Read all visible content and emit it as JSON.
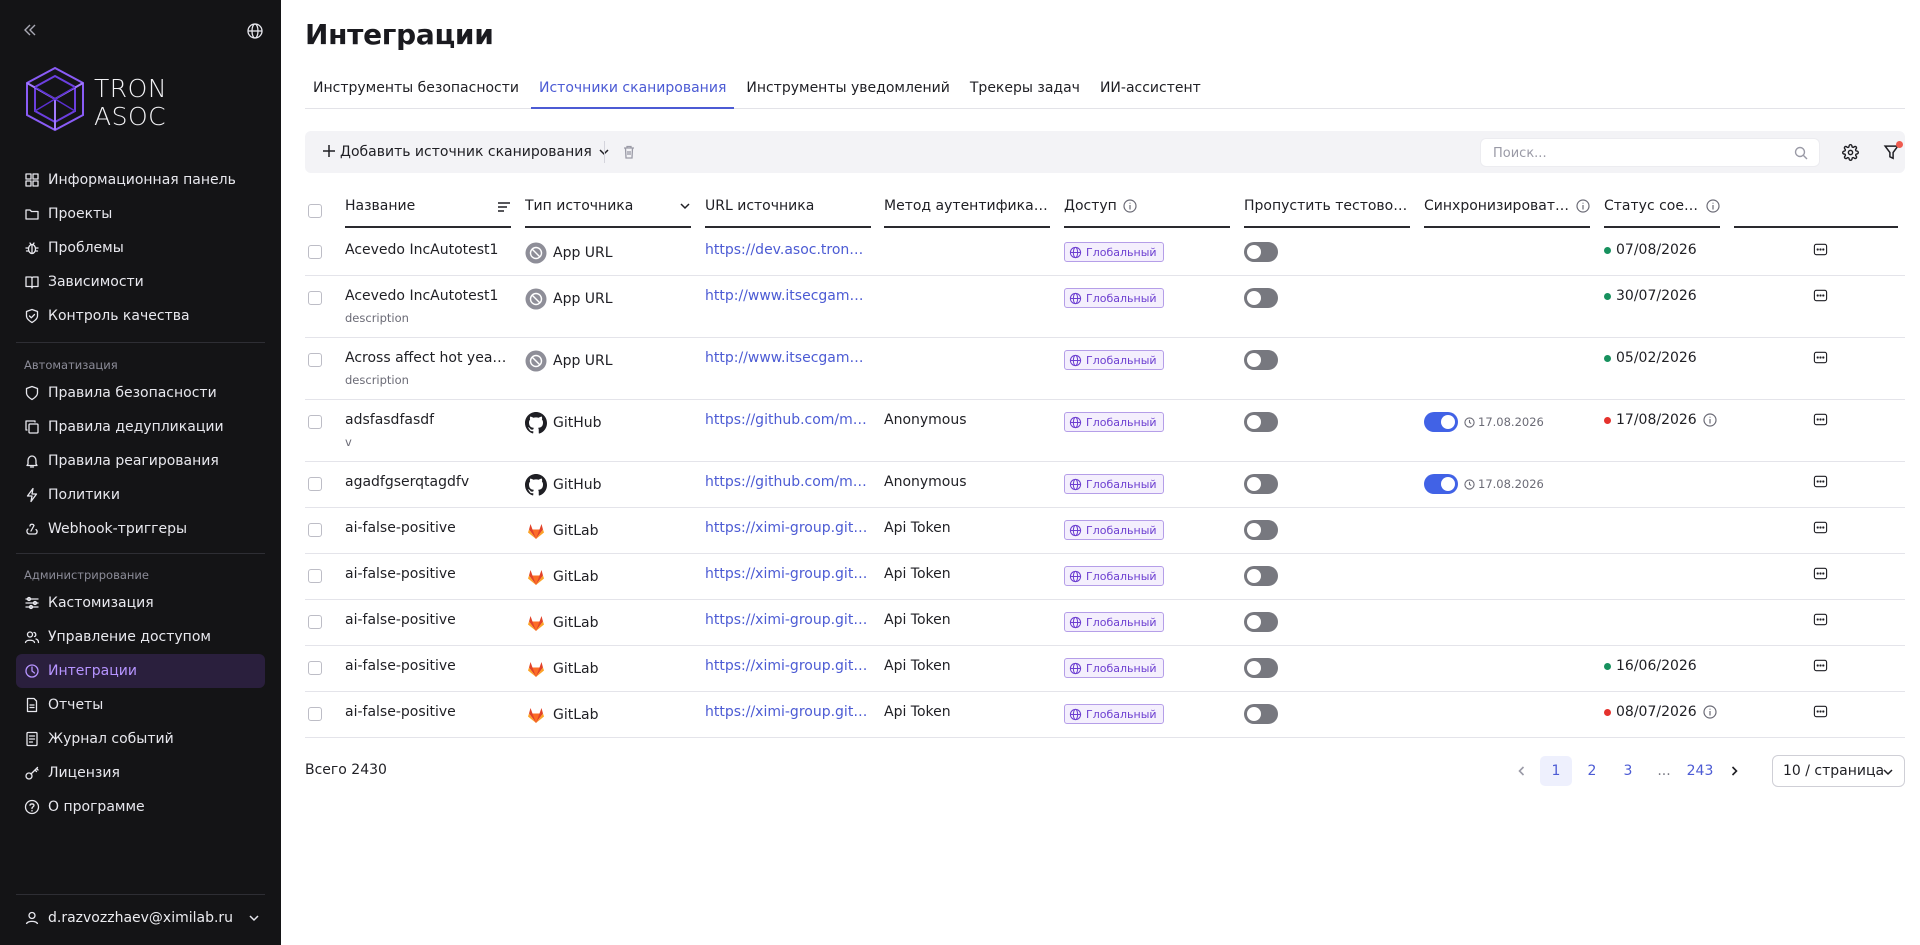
{
  "sidebar": {
    "logo_line1": "TRON",
    "logo_line2": "ASOC",
    "nav_main": [
      {
        "label": "Информационная панель",
        "icon": "dashboard-icon"
      },
      {
        "label": "Проекты",
        "icon": "folder-icon"
      },
      {
        "label": "Проблемы",
        "icon": "bug-icon"
      },
      {
        "label": "Зависимости",
        "icon": "book-icon"
      },
      {
        "label": "Контроль качества",
        "icon": "shield-check-icon"
      }
    ],
    "section_automation": "Автоматизация",
    "nav_automation": [
      {
        "label": "Правила безопасности",
        "icon": "shield-icon"
      },
      {
        "label": "Правила дедупликации",
        "icon": "copy-icon"
      },
      {
        "label": "Правила реагирования",
        "icon": "bell-icon"
      },
      {
        "label": "Политики",
        "icon": "bolt-icon"
      },
      {
        "label": "Webhook-триггеры",
        "icon": "webhook-icon"
      }
    ],
    "section_admin": "Администрирование",
    "nav_admin": [
      {
        "label": "Кастомизация",
        "icon": "sliders-icon"
      },
      {
        "label": "Управление доступом",
        "icon": "users-icon"
      },
      {
        "label": "Интеграции",
        "icon": "integrations-icon",
        "active": true
      },
      {
        "label": "Отчеты",
        "icon": "report-icon"
      },
      {
        "label": "Журнал событий",
        "icon": "journal-icon"
      },
      {
        "label": "Лицензия",
        "icon": "key-icon"
      },
      {
        "label": "О программе",
        "icon": "help-icon"
      }
    ],
    "user": "d.razvozzhaev@ximilab.ru"
  },
  "page": {
    "title": "Интеграции",
    "tabs": [
      {
        "label": "Инструменты безопасности"
      },
      {
        "label": "Источники сканирования",
        "active": true
      },
      {
        "label": "Инструменты уведомлений"
      },
      {
        "label": "Трекеры задач"
      },
      {
        "label": "ИИ-ассистент"
      }
    ]
  },
  "toolbar": {
    "add_label": "Добавить источник сканирования",
    "search_placeholder": "Поиск..."
  },
  "table": {
    "columns": {
      "name": "Название",
      "type": "Тип источника",
      "url": "URL источника",
      "auth": "Метод аутентификации",
      "access": "Доступ",
      "skip": "Пропустить тестовое с...",
      "sync": "Синхронизировать ...",
      "status": "Статус соед..."
    },
    "rows": [
      {
        "name": "Acevedo IncAutotest1",
        "desc": "",
        "type": "App URL",
        "type_icon": "app-url",
        "url": "https://dev.asoc.tronaso...",
        "auth": "",
        "access": "Глобальный",
        "skip": false,
        "sync": null,
        "sync_date": "",
        "status_date": "07/08/2026",
        "status_color": "#17915e",
        "status_info": false
      },
      {
        "name": "Acevedo IncAutotest1",
        "desc": "description",
        "type": "App URL",
        "type_icon": "app-url",
        "url": "http://www.itsecgames....",
        "auth": "",
        "access": "Глобальный",
        "skip": false,
        "sync": null,
        "sync_date": "",
        "status_date": "30/07/2026",
        "status_color": "#17915e",
        "status_info": false
      },
      {
        "name": "Across affect hot year c...",
        "desc": "description",
        "type": "App URL",
        "type_icon": "app-url",
        "url": "http://www.itsecgames....",
        "auth": "",
        "access": "Глобальный",
        "skip": false,
        "sync": null,
        "sync_date": "",
        "status_date": "05/02/2026",
        "status_color": "#17915e",
        "status_info": false
      },
      {
        "name": "adsfasdfasdf",
        "desc": "v",
        "type": "GitHub",
        "type_icon": "github",
        "url": "https://github.com/my-o...",
        "auth": "Anonymous",
        "access": "Глобальный",
        "skip": false,
        "sync": true,
        "sync_date": "17.08.2026",
        "status_date": "17/08/2026",
        "status_color": "#e5322d",
        "status_info": true
      },
      {
        "name": "agadfgserqtagdfv",
        "desc": "",
        "type": "GitHub",
        "type_icon": "github",
        "url": "https://github.com/my-o...",
        "auth": "Anonymous",
        "access": "Глобальный",
        "skip": false,
        "sync": true,
        "sync_date": "17.08.2026",
        "status_date": "",
        "status_color": "",
        "status_info": false
      },
      {
        "name": "ai-false-positive",
        "desc": "",
        "type": "GitLab",
        "type_icon": "gitlab",
        "url": "https://ximi-group.gitlab...",
        "auth": "Api Token",
        "access": "Глобальный",
        "skip": false,
        "sync": null,
        "sync_date": "",
        "status_date": "",
        "status_color": "",
        "status_info": false
      },
      {
        "name": "ai-false-positive",
        "desc": "",
        "type": "GitLab",
        "type_icon": "gitlab",
        "url": "https://ximi-group.gitlab...",
        "auth": "Api Token",
        "access": "Глобальный",
        "skip": false,
        "sync": null,
        "sync_date": "",
        "status_date": "",
        "status_color": "",
        "status_info": false
      },
      {
        "name": "ai-false-positive",
        "desc": "",
        "type": "GitLab",
        "type_icon": "gitlab",
        "url": "https://ximi-group.gitlab...",
        "auth": "Api Token",
        "access": "Глобальный",
        "skip": false,
        "sync": null,
        "sync_date": "",
        "status_date": "",
        "status_color": "",
        "status_info": false
      },
      {
        "name": "ai-false-positive",
        "desc": "",
        "type": "GitLab",
        "type_icon": "gitlab",
        "url": "https://ximi-group.gitlab...",
        "auth": "Api Token",
        "access": "Глобальный",
        "skip": false,
        "sync": null,
        "sync_date": "",
        "status_date": "16/06/2026",
        "status_color": "#17915e",
        "status_info": false
      },
      {
        "name": "ai-false-positive",
        "desc": "",
        "type": "GitLab",
        "type_icon": "gitlab",
        "url": "https://ximi-group.gitlab...",
        "auth": "Api Token",
        "access": "Глобальный",
        "skip": false,
        "sync": null,
        "sync_date": "",
        "status_date": "08/07/2026",
        "status_color": "#e5322d",
        "status_info": true
      }
    ]
  },
  "footer": {
    "total": "Всего 2430",
    "pages": [
      "1",
      "2",
      "3",
      "...",
      "243"
    ],
    "current_page": "1",
    "page_size": "10 / страница"
  },
  "colors": {
    "accent": "#4c5bd4",
    "sidebar_bg": "#141416",
    "active_nav": "#b694ff",
    "toggle_on": "#4162e6",
    "status_ok": "#17915e",
    "status_error": "#e5322d"
  }
}
